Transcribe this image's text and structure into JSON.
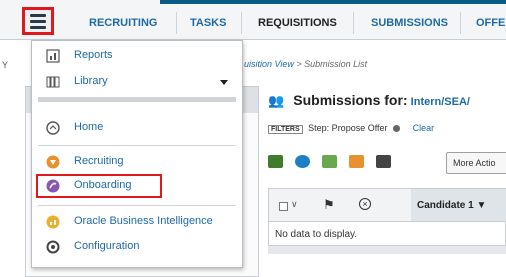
{
  "nav": {
    "tabs": [
      "RECRUITING",
      "TASKS",
      "REQUISITIONS",
      "SUBMISSIONS",
      "OFFE"
    ],
    "active_tab": "REQUISITIONS"
  },
  "breadcrumb": {
    "prefix": "Y",
    "link": "uisition View",
    "separator": " > ",
    "current": "Submission List"
  },
  "submissions": {
    "title": "Submissions for:",
    "requisition": "Intern/SEA/",
    "filters_chip": "FILTERS",
    "filter_step": "Step: Propose Offer",
    "clear_label": "Clear",
    "more_actions": "More Actio",
    "grid": {
      "candidate_col": "Candidate 1 ▼",
      "empty_text": "No data to display."
    }
  },
  "menu": {
    "items": [
      {
        "label": "Reports",
        "icon": "reports-icon"
      },
      {
        "label": "Library",
        "icon": "library-icon"
      },
      {
        "label": "Home",
        "icon": "home-icon"
      },
      {
        "label": "Recruiting",
        "icon": "recruiting-icon"
      },
      {
        "label": "Onboarding",
        "icon": "onboarding-icon"
      },
      {
        "label": "Oracle Business Intelligence",
        "icon": "oracle-bi-icon"
      },
      {
        "label": "Configuration",
        "icon": "configuration-icon"
      }
    ]
  },
  "colors": {
    "accent": "#1f6aa5",
    "highlight_box": "#e0191f",
    "nav_bar": "#0a5a86"
  }
}
